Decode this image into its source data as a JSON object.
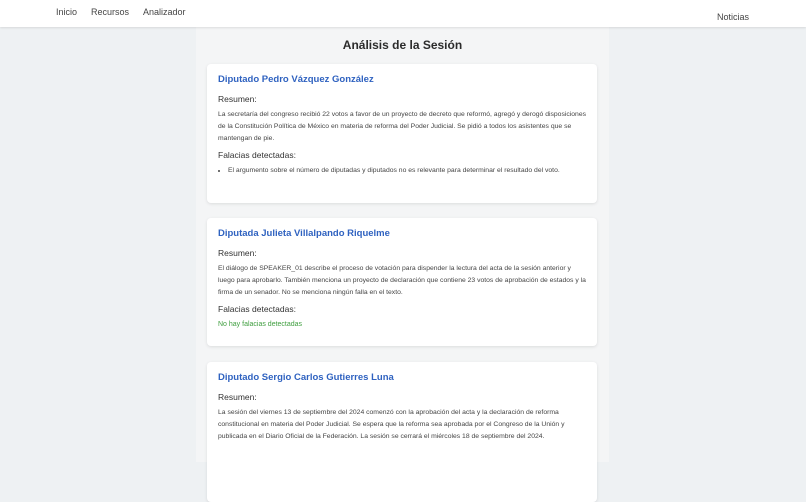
{
  "nav": {
    "items": [
      "Inicio",
      "Recursos",
      "Analizador"
    ],
    "right": "Noticias"
  },
  "page": {
    "title": "Análisis de la Sesión"
  },
  "cards": [
    {
      "name": "Diputado Pedro Vázquez González",
      "summary_label": "Resumen:",
      "summary": "La secretaría del congreso recibió 22 votos a favor de un proyecto de decreto que reformó, agregó y derogó disposiciones de la Constitución Política de México en materia de reforma del Poder Judicial. Se pidió a todos los asistentes que se mantengan de pie.",
      "fallacies_label": "Falacias detectadas:",
      "fallacies": [
        "El argumento sobre el número de diputadas y diputados no es relevante para determinar el resultado del voto."
      ]
    },
    {
      "name": "Diputada Julieta Villalpando Riquelme",
      "summary_label": "Resumen:",
      "summary": "El diálogo de SPEAKER_01 describe el proceso de votación para dispender la lectura del acta de la sesión anterior y luego para aprobarlo. También menciona un proyecto de declaración que contiene 23 votos de aprobación de estados y la firma de un senador. No se menciona ningún falla en el texto.",
      "fallacies_label": "Falacias detectadas:",
      "no_fallacies": "No hay falacias detectadas"
    },
    {
      "name": "Diputado Sergio Carlos Gutierres Luna",
      "summary_label": "Resumen:",
      "summary": "La sesión del viernes 13 de septiembre del 2024 comenzó con la aprobación del acta y la declaración de reforma constitucional en materia del Poder Judicial. Se espera que la reforma sea aprobada por el Congreso de la Unión y publicada en el Diario Oficial de la Federación. La sesión se cerrará el miércoles 18 de septiembre del 2024."
    }
  ]
}
